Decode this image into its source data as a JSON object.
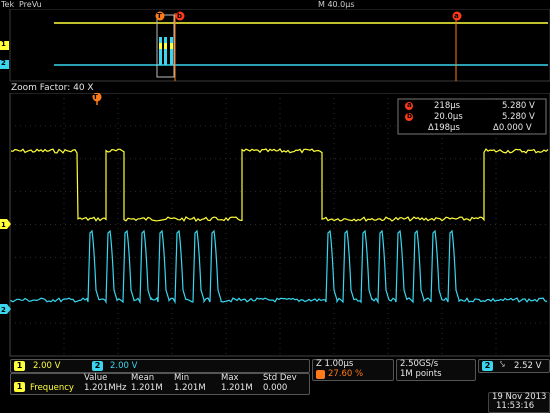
{
  "header": {
    "brand": "Tek",
    "mode": "PreVu",
    "timebase": "M 40.0µs"
  },
  "zoom": {
    "label": "Zoom Factor: 40 X"
  },
  "cursor_readout": {
    "a_time": "218µs",
    "a_volt": "5.280 V",
    "b_time": "20.0µs",
    "b_volt": "5.280 V",
    "delta_time": "Δ198µs",
    "delta_volt": "Δ0.000 V"
  },
  "channels": {
    "ch1_num": "1",
    "ch1_scale": "2.00 V",
    "ch2_num": "2",
    "ch2_scale": "2.00 V"
  },
  "measurement": {
    "headers": [
      "Value",
      "Mean",
      "Min",
      "Max",
      "Std Dev"
    ],
    "name": "Frequency",
    "values": [
      "1.201MHz",
      "1.201M",
      "1.201M",
      "1.201M",
      "0.000"
    ]
  },
  "horizontal": {
    "zoom_scale": "Z 1.00µs",
    "trigger_pos": "27.60 %"
  },
  "acquisition": {
    "rate": "2.50GS/s",
    "points": "1M points"
  },
  "trigger": {
    "source": "2",
    "slope": "⤥",
    "level": "2.52 V"
  },
  "datetime": {
    "date": "19 Nov 2013",
    "time": "11:53:16"
  },
  "markers": {
    "a": "a",
    "b": "b",
    "t": "T"
  },
  "colors": {
    "ch1": "#ffff3a",
    "ch2": "#39d6ee",
    "cursor": "#ff7a1a"
  }
}
